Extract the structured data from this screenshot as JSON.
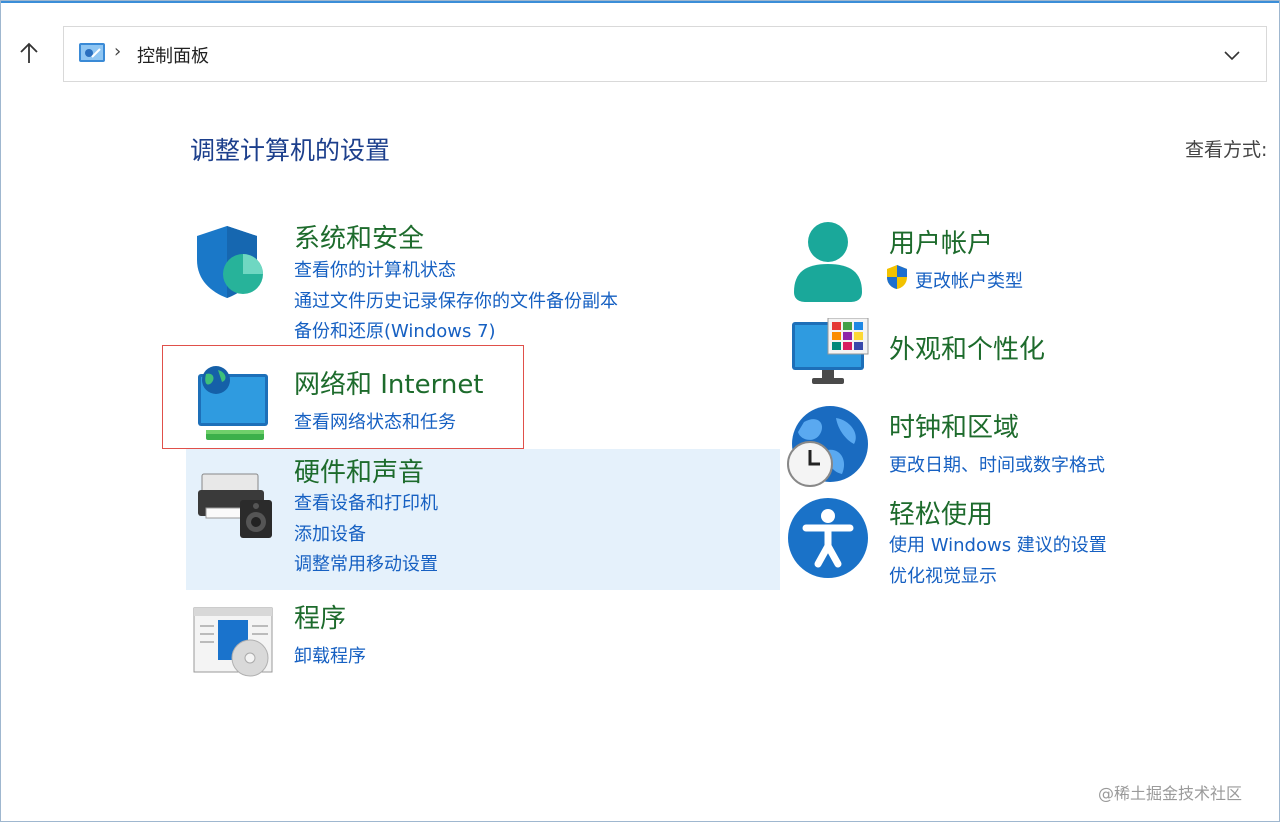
{
  "address_bar": {
    "breadcrumb": "控制面板",
    "separator": "›"
  },
  "page": {
    "title": "调整计算机的设置",
    "view_by_label": "查看方式:"
  },
  "categories": {
    "system_security": {
      "title": "系统和安全",
      "links": [
        "查看你的计算机状态",
        "通过文件历史记录保存你的文件备份副本",
        "备份和还原(Windows 7)"
      ],
      "icon": "shield-icon"
    },
    "network_internet": {
      "title": "网络和 Internet",
      "links": [
        "查看网络状态和任务"
      ],
      "icon": "network-globe-icon"
    },
    "hardware_sound": {
      "title": "硬件和声音",
      "links": [
        "查看设备和打印机",
        "添加设备",
        "调整常用移动设置"
      ],
      "icon": "printer-speaker-icon"
    },
    "programs": {
      "title": "程序",
      "links": [
        "卸载程序"
      ],
      "icon": "programs-disc-icon"
    },
    "user_accounts": {
      "title": "用户帐户",
      "links": [
        "更改帐户类型"
      ],
      "icon": "user-icon"
    },
    "appearance": {
      "title": "外观和个性化",
      "links": [],
      "icon": "monitor-tiles-icon"
    },
    "clock_region": {
      "title": "时钟和区域",
      "links": [
        "更改日期、时间或数字格式"
      ],
      "icon": "globe-clock-icon"
    },
    "ease_of_access": {
      "title": "轻松使用",
      "links": [
        "使用 Windows 建议的设置",
        "优化视觉显示"
      ],
      "icon": "accessibility-icon"
    }
  },
  "watermark": "@稀土掘金技术社区",
  "colors": {
    "category_title": "#1d6b2c",
    "link": "#1660c2",
    "page_title": "#1c3f8c",
    "highlight_border": "#e0504a",
    "hover_bg": "#e5f1fb"
  }
}
